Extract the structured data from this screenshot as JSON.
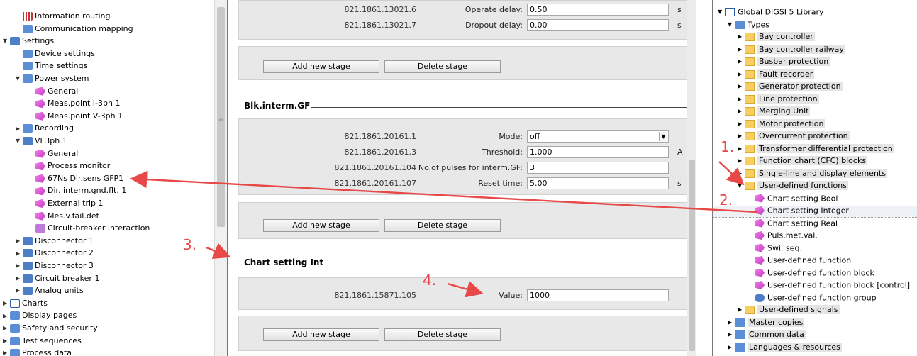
{
  "left_tree": {
    "items": [
      {
        "label": "Information routing",
        "indent": 1,
        "icon": "grid-icon",
        "expander": ""
      },
      {
        "label": "Communication mapping",
        "indent": 1,
        "icon": "routing-icon",
        "expander": ""
      },
      {
        "label": "Settings",
        "indent": 0,
        "icon": "folder-settings-icon",
        "expander": "▼"
      },
      {
        "label": "Device settings",
        "indent": 1,
        "icon": "device-settings-icon",
        "expander": ""
      },
      {
        "label": "Time settings",
        "indent": 1,
        "icon": "time-settings-icon",
        "expander": ""
      },
      {
        "label": "Power system",
        "indent": 1,
        "icon": "power-system-icon",
        "expander": "▼"
      },
      {
        "label": "General",
        "indent": 2,
        "icon": "function-icon",
        "expander": ""
      },
      {
        "label": "Meas.point I-3ph 1",
        "indent": 2,
        "icon": "function-icon",
        "expander": ""
      },
      {
        "label": "Meas.point V-3ph 1",
        "indent": 2,
        "icon": "function-icon",
        "expander": ""
      },
      {
        "label": "Recording",
        "indent": 1,
        "icon": "recording-icon",
        "expander": "▶"
      },
      {
        "label": "VI 3ph 1",
        "indent": 1,
        "icon": "function-group-icon",
        "expander": "▼"
      },
      {
        "label": "General",
        "indent": 2,
        "icon": "function-icon",
        "expander": ""
      },
      {
        "label": "Process monitor",
        "indent": 2,
        "icon": "function-icon",
        "expander": ""
      },
      {
        "label": "67Ns Dir.sens GFP1",
        "indent": 2,
        "icon": "function-icon",
        "expander": ""
      },
      {
        "label": "Dir. interm.gnd.flt. 1",
        "indent": 2,
        "icon": "function-icon",
        "expander": ""
      },
      {
        "label": "External trip 1",
        "indent": 2,
        "icon": "function-icon",
        "expander": ""
      },
      {
        "label": "Mes.v.fail.det",
        "indent": 2,
        "icon": "function-icon",
        "expander": ""
      },
      {
        "label": "Circuit-breaker interaction",
        "indent": 2,
        "icon": "interaction-icon",
        "expander": ""
      },
      {
        "label": "Disconnector 1",
        "indent": 1,
        "icon": "function-group-icon",
        "expander": "▶"
      },
      {
        "label": "Disconnector 2",
        "indent": 1,
        "icon": "function-group-icon",
        "expander": "▶"
      },
      {
        "label": "Disconnector 3",
        "indent": 1,
        "icon": "function-group-icon",
        "expander": "▶"
      },
      {
        "label": "Circuit breaker 1",
        "indent": 1,
        "icon": "function-group-icon",
        "expander": "▶"
      },
      {
        "label": "Analog units",
        "indent": 1,
        "icon": "function-group-icon",
        "expander": "▶"
      },
      {
        "label": "Charts",
        "indent": 0,
        "icon": "charts-icon",
        "expander": "▶"
      },
      {
        "label": "Display pages",
        "indent": 0,
        "icon": "display-pages-icon",
        "expander": "▶"
      },
      {
        "label": "Safety and security",
        "indent": 0,
        "icon": "safety-icon",
        "expander": "▶"
      },
      {
        "label": "Test sequences",
        "indent": 0,
        "icon": "test-sequences-icon",
        "expander": "▶"
      },
      {
        "label": "Process data",
        "indent": 0,
        "icon": "process-data-icon",
        "expander": "▶"
      }
    ]
  },
  "center": {
    "stage1": {
      "rows": [
        {
          "address": "821.1861.13021.6",
          "label": "Operate delay:",
          "value": "0.50",
          "unit": "s"
        },
        {
          "address": "821.1861.13021.7",
          "label": "Dropout delay:",
          "value": "0.00",
          "unit": "s"
        }
      ]
    },
    "buttons": {
      "add": "Add new stage",
      "delete": "Delete stage"
    },
    "blk_section": {
      "title": "Blk.interm.GF",
      "rows": [
        {
          "address": "821.1861.20161.1",
          "label": "Mode:",
          "value": "off",
          "unit": ""
        },
        {
          "address": "821.1861.20161.3",
          "label": "Threshold:",
          "value": "1.000",
          "unit": "A"
        },
        {
          "address": "821.1861.20161.104",
          "label": "No.of pulses for interm.GF:",
          "value": "3",
          "unit": ""
        },
        {
          "address": "821.1861.20161.107",
          "label": "Reset time:",
          "value": "5.00",
          "unit": "s"
        }
      ]
    },
    "chart_section": {
      "title": "Chart setting Int",
      "rows": [
        {
          "address": "821.1861.15871.105",
          "label": "Value:",
          "value": "1000",
          "unit": ""
        }
      ]
    }
  },
  "library": {
    "items": [
      {
        "label": "Global DIGSI 5 Library",
        "indent": 0,
        "icon": "library-book-icon",
        "expander": "▼",
        "highlight": false
      },
      {
        "label": "Types",
        "indent": 1,
        "icon": "types-icon",
        "expander": "▼",
        "highlight": false
      },
      {
        "label": "Bay controller",
        "indent": 2,
        "icon": "folder-icon",
        "expander": "▶",
        "highlight": true
      },
      {
        "label": "Bay controller railway",
        "indent": 2,
        "icon": "folder-icon",
        "expander": "▶",
        "highlight": true
      },
      {
        "label": "Busbar protection",
        "indent": 2,
        "icon": "folder-icon",
        "expander": "▶",
        "highlight": true
      },
      {
        "label": "Fault recorder",
        "indent": 2,
        "icon": "folder-icon",
        "expander": "▶",
        "highlight": true
      },
      {
        "label": "Generator protection",
        "indent": 2,
        "icon": "folder-icon",
        "expander": "▶",
        "highlight": true
      },
      {
        "label": "Line protection",
        "indent": 2,
        "icon": "folder-icon",
        "expander": "▶",
        "highlight": true
      },
      {
        "label": "Merging Unit",
        "indent": 2,
        "icon": "folder-icon",
        "expander": "▶",
        "highlight": true
      },
      {
        "label": "Motor protection",
        "indent": 2,
        "icon": "folder-icon",
        "expander": "▶",
        "highlight": true
      },
      {
        "label": "Overcurrent protection",
        "indent": 2,
        "icon": "folder-icon",
        "expander": "▶",
        "highlight": true
      },
      {
        "label": "Transformer differential protection",
        "indent": 2,
        "icon": "folder-icon",
        "expander": "▶",
        "highlight": true
      },
      {
        "label": "Function chart (CFC) blocks",
        "indent": 2,
        "icon": "folder-icon",
        "expander": "▶",
        "highlight": true
      },
      {
        "label": "Single-line and display elements",
        "indent": 2,
        "icon": "folder-icon",
        "expander": "▶",
        "highlight": true
      },
      {
        "label": "User-defined functions",
        "indent": 2,
        "icon": "folder-icon",
        "expander": "▼",
        "highlight": true
      },
      {
        "label": "Chart setting Bool",
        "indent": 3,
        "icon": "function-icon",
        "expander": "",
        "highlight": false
      },
      {
        "label": "Chart setting Integer",
        "indent": 3,
        "icon": "function-icon",
        "expander": "",
        "highlight": false
      },
      {
        "label": "Chart setting Real",
        "indent": 3,
        "icon": "function-icon",
        "expander": "",
        "highlight": false
      },
      {
        "label": "Puls.met.val.",
        "indent": 3,
        "icon": "function-icon",
        "expander": "",
        "highlight": false
      },
      {
        "label": "Swi. seq.",
        "indent": 3,
        "icon": "function-icon",
        "expander": "",
        "highlight": false
      },
      {
        "label": "User-defined function",
        "indent": 3,
        "icon": "function-icon",
        "expander": "",
        "highlight": false
      },
      {
        "label": "User-defined function block",
        "indent": 3,
        "icon": "function-icon",
        "expander": "",
        "highlight": false
      },
      {
        "label": "User-defined function block [control]",
        "indent": 3,
        "icon": "function-icon",
        "expander": "",
        "highlight": false
      },
      {
        "label": "User-defined function group",
        "indent": 3,
        "icon": "function-group-icon",
        "expander": "",
        "highlight": false
      },
      {
        "label": "User-defined signals",
        "indent": 2,
        "icon": "folder-icon",
        "expander": "▶",
        "highlight": true
      },
      {
        "label": "Master copies",
        "indent": 1,
        "icon": "master-copies-icon",
        "expander": "▶",
        "highlight": true
      },
      {
        "label": "Common data",
        "indent": 1,
        "icon": "common-data-icon",
        "expander": "▶",
        "highlight": true
      },
      {
        "label": "Languages & resources",
        "indent": 1,
        "icon": "languages-icon",
        "expander": "▶",
        "highlight": true
      }
    ]
  },
  "annotations": {
    "n1": "1.",
    "n2": "2.",
    "n3": "3.",
    "n4": "4."
  },
  "colors": {
    "annotation": "#e84848",
    "highlight": "#e4e4e4",
    "folder": "#f6cf60"
  }
}
